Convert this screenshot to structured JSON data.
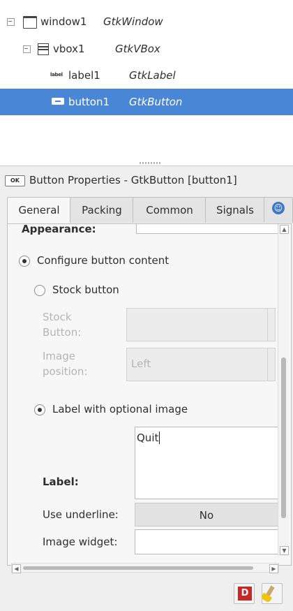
{
  "tree": {
    "rows": [
      {
        "name": "window1",
        "type": "GtkWindow"
      },
      {
        "name": "vbox1",
        "type": "GtkVBox"
      },
      {
        "name": "label1",
        "type": "GtkLabel"
      },
      {
        "name": "button1",
        "type": "GtkButton"
      }
    ],
    "label_icon_text": "label"
  },
  "properties": {
    "ok_icon_text": "OK",
    "title": "Button Properties - GtkButton [button1]"
  },
  "tabs": [
    "General",
    "Packing",
    "Common",
    "Signals"
  ],
  "general": {
    "appearance_heading": "Appearance:",
    "configure_content": "Configure button content",
    "stock_button_option": "Stock button",
    "stock_button_label": "Stock\nButton:",
    "image_position_label": "Image\nposition:",
    "image_position_value": "Left",
    "label_with_image": "Label with optional image",
    "label_label": "Label:",
    "label_value": "Quit",
    "use_underline_label": "Use underline:",
    "use_underline_value": "No",
    "image_widget_label": "Image widget:"
  },
  "toolbar": {
    "devhelp_icon_text": "D"
  },
  "colors": {
    "selection": "#4a86d6",
    "accessibility": "#3f77c9",
    "devhelp": "#c62828"
  }
}
